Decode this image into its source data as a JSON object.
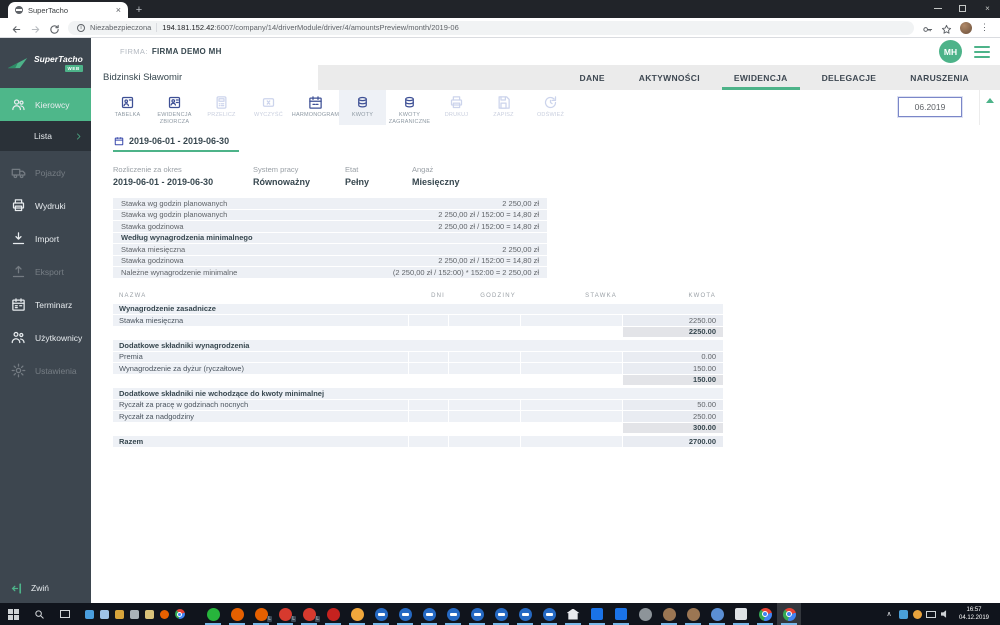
{
  "browser": {
    "tab_title": "SuperTacho",
    "new_tab_label": "+",
    "security_label": "Niezabezpieczona",
    "url_host": "194.181.152.42",
    "url_path": ":6007/company/14/driverModule/driver/4/amountsPreview/month/2019-06"
  },
  "sidebar": {
    "logo_title": "SuperTacho",
    "logo_badge": "WEB",
    "items": [
      {
        "name": "kierowcy",
        "label": "Kierowcy",
        "icon": "drivers",
        "state": "active"
      },
      {
        "name": "lista",
        "label": "Lista",
        "submenu": true
      },
      {
        "name": "pojazdy",
        "label": "Pojazdy",
        "icon": "truck",
        "state": "dimmed"
      },
      {
        "name": "wydruki",
        "label": "Wydruki",
        "icon": "printer",
        "state": "normal"
      },
      {
        "name": "import",
        "label": "Import",
        "icon": "import",
        "state": "normal"
      },
      {
        "name": "eksport",
        "label": "Eksport",
        "icon": "export",
        "state": "dimmed"
      },
      {
        "name": "terminarz",
        "label": "Terminarz",
        "icon": "calendar",
        "state": "normal"
      },
      {
        "name": "uzytkownicy",
        "label": "Użytkownicy",
        "icon": "users",
        "state": "normal"
      },
      {
        "name": "ustawienia",
        "label": "Ustawienia",
        "icon": "gear",
        "state": "dimmed"
      }
    ],
    "collapse_label": "Zwiń"
  },
  "header": {
    "company_label": "FIRMA:",
    "company_name": "FIRMA DEMO MH",
    "avatar_initials": "MH"
  },
  "driver_tabs": {
    "driver_name": "Bidzinski Sławomir",
    "tabs": [
      {
        "name": "dane",
        "label": "DANE"
      },
      {
        "name": "aktywnosci",
        "label": "AKTYWNOŚCI"
      },
      {
        "name": "ewidencja",
        "label": "EWIDENCJA",
        "active": true
      },
      {
        "name": "delegacje",
        "label": "DELEGACJE"
      },
      {
        "name": "naruszenia",
        "label": "NARUSZENIA"
      }
    ]
  },
  "toolbar": {
    "buttons": [
      {
        "name": "tabelka",
        "label": "TABELKA",
        "icon": "tabelka",
        "state": "enabled"
      },
      {
        "name": "ewidencja-zbiorcza",
        "label": "EWIDENCJA ZBIORCZA",
        "icon": "ewidencja",
        "state": "enabled"
      },
      {
        "name": "przelicz",
        "label": "PRZELICZ",
        "icon": "przelicz",
        "state": "disabled"
      },
      {
        "name": "wyczysc",
        "label": "WYCZYŚĆ",
        "icon": "wyczysc",
        "state": "disabled"
      },
      {
        "name": "harmonogram",
        "label": "HARMONOGRAM",
        "icon": "harmonogram",
        "state": "enabled"
      },
      {
        "name": "kwoty",
        "label": "KWOTY",
        "icon": "kwoty",
        "state": "active"
      },
      {
        "name": "kwoty-zagraniczne",
        "label": "KWOTY ZAGRANICZNE",
        "icon": "kwoty",
        "state": "enabled"
      },
      {
        "name": "drukuj",
        "label": "DRUKUJ",
        "icon": "printer",
        "state": "disabled"
      },
      {
        "name": "zapisz",
        "label": "ZAPISZ",
        "icon": "zapisz",
        "state": "disabled"
      },
      {
        "name": "odswiez",
        "label": "ODŚWIEŻ",
        "icon": "odswiez",
        "state": "disabled"
      }
    ],
    "month_value": "06.2019"
  },
  "period": {
    "range_label": "2019-06-01 - 2019-06-30",
    "info": [
      {
        "label": "Rozliczenie za okres",
        "value": "2019-06-01 - 2019-06-30"
      },
      {
        "label": "System pracy",
        "value": "Równoważny"
      },
      {
        "label": "Etat",
        "value": "Pełny"
      },
      {
        "label": "Angaż",
        "value": "Miesięczny"
      }
    ]
  },
  "rates_table": {
    "rows": [
      {
        "type": "data",
        "label": "Stawka wg godzin planowanych",
        "value": "2 250,00 zł"
      },
      {
        "type": "data",
        "label": "Stawka wg godzin planowanych",
        "value": "2 250,00 zł / 152:00 = 14,80 zł"
      },
      {
        "type": "data",
        "label": "Stawka godzinowa",
        "value": "2 250,00 zł / 152:00 = 14,80 zł"
      },
      {
        "type": "section",
        "label": "Według wynagrodzenia minimalnego",
        "value": ""
      },
      {
        "type": "data",
        "label": "Stawka miesięczna",
        "value": "2 250,00 zł"
      },
      {
        "type": "data",
        "label": "Stawka godzinowa",
        "value": "2 250,00 zł / 152:00 = 14,80 zł"
      },
      {
        "type": "data",
        "label": "Należne wynagrodzenie minimalne",
        "value": "(2 250,00 zł / 152:00) * 152:00 = 2 250,00 zł"
      }
    ]
  },
  "amounts_table": {
    "headers": [
      "NAZWA",
      "DNI",
      "GODZINY",
      "STAWKA",
      "KWOTA"
    ],
    "rows": [
      {
        "type": "section",
        "name": "Wynagrodzenie zasadnicze"
      },
      {
        "type": "data",
        "name": "Stawka miesięczna",
        "dni": "",
        "godziny": "",
        "stawka": "",
        "kwota": "2250.00"
      },
      {
        "type": "subtotal",
        "kwota": "2250.00"
      },
      {
        "type": "section",
        "name": "Dodatkowe składniki wynagrodzenia"
      },
      {
        "type": "data",
        "name": "Premia",
        "dni": "",
        "godziny": "",
        "stawka": "",
        "kwota": "0.00"
      },
      {
        "type": "data",
        "name": "Wynagrodzenie za dyżur (ryczałtowe)",
        "dni": "",
        "godziny": "",
        "stawka": "",
        "kwota": "150.00"
      },
      {
        "type": "subtotal",
        "kwota": "150.00"
      },
      {
        "type": "section",
        "name": "Dodatkowe składniki nie wchodzące do kwoty minimalnej"
      },
      {
        "type": "data",
        "name": "Ryczałt za pracę w godzinach nocnych",
        "dni": "",
        "godziny": "",
        "stawka": "",
        "kwota": "50.00"
      },
      {
        "type": "data",
        "name": "Ryczałt za nadgodziny",
        "dni": "",
        "godziny": "",
        "stawka": "",
        "kwota": "250.00"
      },
      {
        "type": "subtotal",
        "kwota": "300.00"
      },
      {
        "type": "total",
        "name": "Razem",
        "kwota": "2700.00"
      }
    ]
  },
  "taskbar": {
    "small_icons": [
      {
        "name": "mail",
        "color": "#4a9ede"
      },
      {
        "name": "display",
        "color": "#9fc3e8"
      },
      {
        "name": "storage",
        "color": "#d7a43b"
      },
      {
        "name": "media",
        "color": "#aab2b8"
      },
      {
        "name": "files",
        "color": "#d9c27a"
      },
      {
        "name": "firefox-small",
        "color": "#e66000",
        "round": true
      },
      {
        "name": "chrome-small",
        "kind": "chrome"
      }
    ],
    "apps": [
      {
        "name": "whatsapp",
        "kind": "circle",
        "color": "#27b53c",
        "running": true
      },
      {
        "name": "firefox",
        "kind": "circle",
        "color": "#e66000",
        "running": true
      },
      {
        "name": "firefox-2",
        "kind": "circle",
        "color": "#e66000",
        "running": true,
        "badge": "L"
      },
      {
        "name": "thunderbird",
        "kind": "circle",
        "color": "#d73a2e",
        "running": true,
        "badge": "L"
      },
      {
        "name": "thunderbird-2",
        "kind": "circle",
        "color": "#d73a2e",
        "running": true,
        "badge": "L"
      },
      {
        "name": "app-red",
        "kind": "circle",
        "color": "#c5221f",
        "running": true
      },
      {
        "name": "app-orange",
        "kind": "circle",
        "color": "#f0a73c",
        "running": true
      },
      {
        "name": "teamviewer-1",
        "kind": "tv",
        "color": "#2569c3",
        "running": true
      },
      {
        "name": "teamviewer-2",
        "kind": "tv",
        "color": "#2569c3",
        "running": true
      },
      {
        "name": "teamviewer-3",
        "kind": "tv",
        "color": "#2569c3",
        "running": true
      },
      {
        "name": "teamviewer-4",
        "kind": "tv",
        "color": "#2569c3",
        "running": true
      },
      {
        "name": "teamviewer-5",
        "kind": "tv",
        "color": "#2569c3",
        "running": true
      },
      {
        "name": "teamviewer-6",
        "kind": "tv",
        "color": "#2569c3",
        "running": true
      },
      {
        "name": "teamviewer-7",
        "kind": "tv",
        "color": "#2569c3",
        "running": true
      },
      {
        "name": "teamviewer-8",
        "kind": "tv",
        "color": "#2569c3",
        "running": true
      },
      {
        "name": "home",
        "kind": "home",
        "running": true
      },
      {
        "name": "teamviewer-sq-1",
        "kind": "square",
        "color": "#1a73e8",
        "running": true
      },
      {
        "name": "teamviewer-sq-2",
        "kind": "square",
        "color": "#1a73e8",
        "running": true
      },
      {
        "name": "app-globe",
        "kind": "circle",
        "color": "#8d9499",
        "running": false
      },
      {
        "name": "gimp",
        "kind": "circle",
        "color": "#9b7653",
        "running": true
      },
      {
        "name": "gimp-2",
        "kind": "circle",
        "color": "#9b7653",
        "running": true
      },
      {
        "name": "app-blue",
        "kind": "circle",
        "color": "#5b8fd4",
        "running": true
      },
      {
        "name": "notes",
        "kind": "square",
        "color": "#dfe3e6",
        "running": true
      },
      {
        "name": "chrome",
        "kind": "chrome",
        "running": true
      },
      {
        "name": "chrome-2",
        "kind": "chrome",
        "running": true,
        "active": true
      }
    ],
    "tray_time": "16:57",
    "tray_date": "04.12.2019"
  },
  "colors": {
    "accent_green": "#4db389",
    "sidebar_dark": "#3d464f",
    "toolbar_blue": "#3e5095",
    "row_bg": "#eef1f6"
  }
}
